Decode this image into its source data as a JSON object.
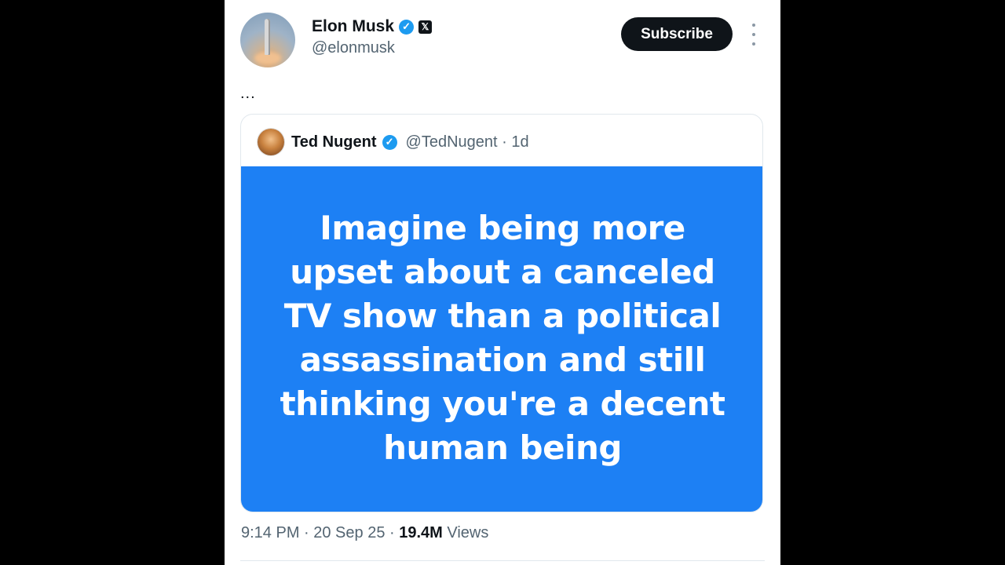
{
  "author": {
    "name": "Elon Musk",
    "handle": "@elonmusk",
    "verified_icon": "verified-badge-icon",
    "affiliate_icon": "x-logo-icon"
  },
  "subscribe_label": "Subscribe",
  "tweet_text": "...",
  "quoted": {
    "name": "Ted Nugent",
    "handle_time": "@TedNugent · 1d",
    "image_text": "Imagine being more upset about a canceled TV show than a political assassination and still thinking you're a decent human being",
    "image_bg_color": "#1d80f4"
  },
  "meta": {
    "time_date": "9:14 PM · 20 Sep 25 · ",
    "views_count": "19.4M",
    "views_label": " Views"
  },
  "colors": {
    "verified_blue": "#1d9bf0",
    "text_primary": "#0f1419",
    "text_secondary": "#536471"
  }
}
